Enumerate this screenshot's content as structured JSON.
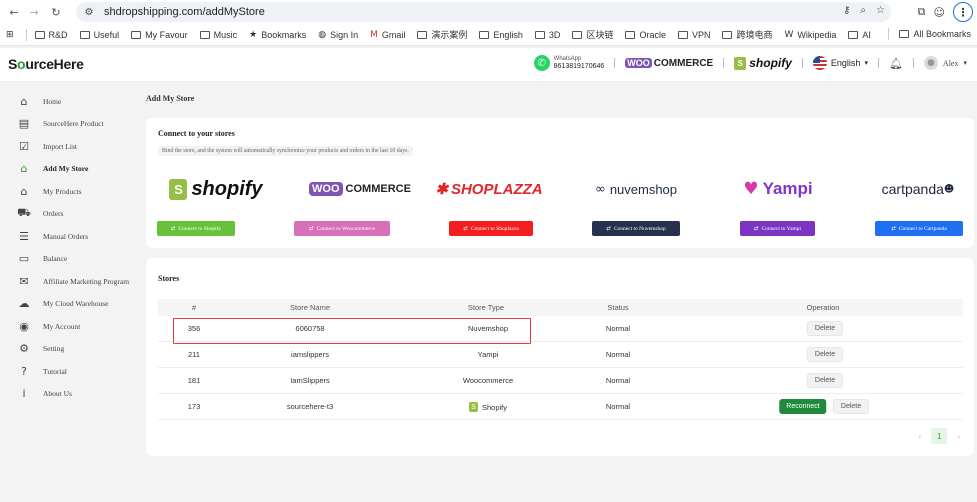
{
  "browser": {
    "url": "shdropshipping.com/addMyStore",
    "bookmarks": [
      {
        "label": "R&D",
        "icon": "folder-icon"
      },
      {
        "label": "Useful",
        "icon": "folder-icon"
      },
      {
        "label": "My Favour",
        "icon": "folder-icon"
      },
      {
        "label": "Music",
        "icon": "folder-icon"
      },
      {
        "label": "Bookmarks",
        "icon": "star-icon"
      },
      {
        "label": "Sign In",
        "icon": "globe-icon"
      },
      {
        "label": "Gmail",
        "icon": "gmail-icon"
      },
      {
        "label": "演示案例",
        "icon": "folder-icon"
      },
      {
        "label": "English",
        "icon": "folder-icon"
      },
      {
        "label": "3D",
        "icon": "folder-icon"
      },
      {
        "label": "区块链",
        "icon": "folder-icon"
      },
      {
        "label": "Oracle",
        "icon": "folder-icon"
      },
      {
        "label": "VPN",
        "icon": "folder-icon"
      },
      {
        "label": "跨境电商",
        "icon": "folder-icon"
      },
      {
        "label": "Wikipedia",
        "icon": "wikipedia-icon"
      },
      {
        "label": "AI",
        "icon": "folder-icon"
      }
    ],
    "all_bookmarks": "All Bookmarks"
  },
  "header": {
    "logo": {
      "pre": "S",
      "o": "o",
      "post": "urceHere"
    },
    "whatsapp_label": "WhatsApp",
    "whatsapp_number": "8613819170646",
    "woo_badge": "WOO",
    "woo_text": "COMMERCE",
    "shopify_text": "shopify",
    "language": "English",
    "user": "Alex"
  },
  "sidebar": {
    "items": [
      {
        "label": "Home",
        "icon": "home-icon",
        "glyph": "⌂"
      },
      {
        "label": "SourceHere Product",
        "icon": "product-box-icon",
        "glyph": "▤"
      },
      {
        "label": "Import List",
        "icon": "clipboard-icon",
        "glyph": "☑"
      },
      {
        "label": "Add My Store",
        "icon": "store-icon",
        "glyph": "⌂",
        "active": true
      },
      {
        "label": "My Products",
        "icon": "warehouse-icon",
        "glyph": "⌂"
      },
      {
        "label": "Orders",
        "icon": "cart-icon",
        "glyph": "⛟"
      },
      {
        "label": "Manual Orders",
        "icon": "manual-orders-icon",
        "glyph": "☰"
      },
      {
        "label": "Balance",
        "icon": "wallet-icon",
        "glyph": "▭"
      },
      {
        "label": "Affiliate Marketing Program",
        "icon": "mail-icon",
        "glyph": "✉"
      },
      {
        "label": "My Cloud Warehouse",
        "icon": "cloud-icon",
        "glyph": "☁"
      },
      {
        "label": "My Account",
        "icon": "account-icon",
        "glyph": "◉"
      },
      {
        "label": "Setting",
        "icon": "gear-icon",
        "glyph": "⚙"
      },
      {
        "label": "Tutorial",
        "icon": "help-icon",
        "glyph": "?"
      },
      {
        "label": "About Us",
        "icon": "info-icon",
        "glyph": "i"
      }
    ]
  },
  "main": {
    "title": "Add My Store",
    "connect": {
      "title": "Connect to your stores",
      "hint": "Bind the store, and the system will automatically synchronize your products and orders in the last 10 days.",
      "platforms": [
        {
          "name": "shopify",
          "button": "Connect to Shopify",
          "color": "#67c23a"
        },
        {
          "name": "WooCommerce",
          "badge": "WOO",
          "text": "COMMERCE",
          "button": "Connect to Woocommerce",
          "color": "#d86fb9"
        },
        {
          "name": "SHOPLAZZA",
          "button": "Connect to Shoplazza",
          "color": "#f31e1e"
        },
        {
          "name": "nuvemshop",
          "button": "Connect to Nuvemshop",
          "color": "#28304f"
        },
        {
          "name": "Yampi",
          "button": "Connect to Yampi",
          "color": "#7b35c2"
        },
        {
          "name": "cartpanda",
          "button": "Connect to Cartpanda",
          "color": "#1f6ff2"
        }
      ]
    },
    "stores": {
      "title": "Stores",
      "columns": [
        "#",
        "Store Name",
        "Store Type",
        "Status",
        "Operation"
      ],
      "rows": [
        {
          "id": "356",
          "name": "6060758",
          "type": "Nuvemshop",
          "status": "Normal",
          "actions": [
            "Delete"
          ]
        },
        {
          "id": "211",
          "name": "iamslippers",
          "type": "Yampi",
          "status": "Normal",
          "actions": [
            "Delete"
          ]
        },
        {
          "id": "181",
          "name": "IamSlippers",
          "type": "Woocommerce",
          "status": "Normal",
          "actions": [
            "Delete"
          ]
        },
        {
          "id": "173",
          "name": "sourcehere-t3",
          "type": "Shopify",
          "status": "Normal",
          "actions": [
            "Reconnect",
            "Delete"
          ]
        }
      ],
      "pagination": {
        "prev": "‹",
        "current": "1",
        "next": "›"
      }
    }
  }
}
